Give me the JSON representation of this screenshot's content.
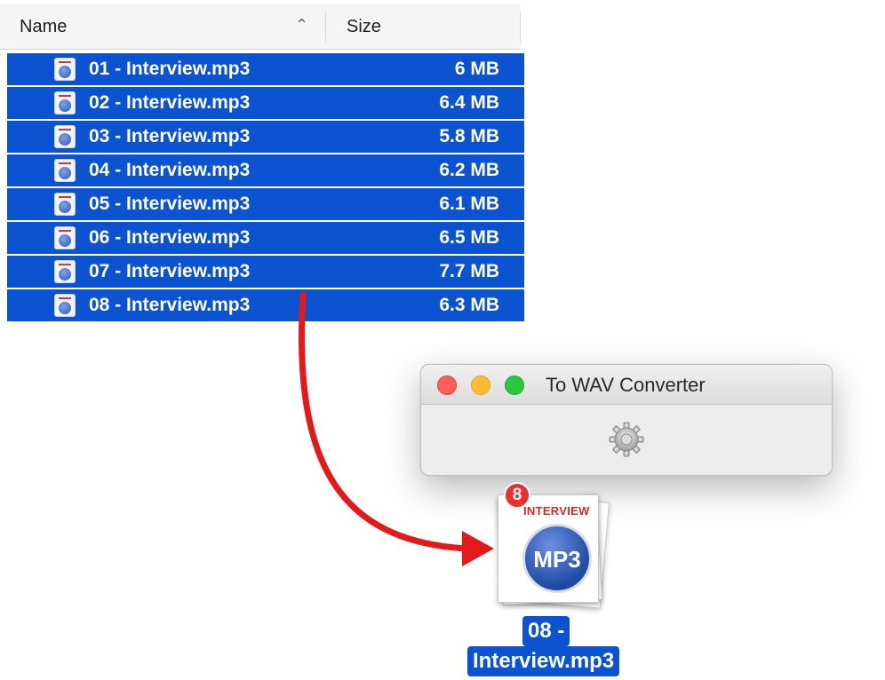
{
  "finder": {
    "columns": {
      "name": "Name",
      "size": "Size"
    },
    "rows": [
      {
        "name": "01 - Interview.mp3",
        "size": "6 MB"
      },
      {
        "name": "02 - Interview.mp3",
        "size": "6.4 MB"
      },
      {
        "name": "03 - Interview.mp3",
        "size": "5.8 MB"
      },
      {
        "name": "04 - Interview.mp3",
        "size": "6.2 MB"
      },
      {
        "name": "05 - Interview.mp3",
        "size": "6.1 MB"
      },
      {
        "name": "06 - Interview.mp3",
        "size": "6.5 MB"
      },
      {
        "name": "07 - Interview.mp3",
        "size": "7.7 MB"
      },
      {
        "name": "08 - Interview.mp3",
        "size": "6.3 MB"
      }
    ],
    "sort_icon": "chevron-up-icon",
    "selection_color": "#0b53d0"
  },
  "app_window": {
    "title": "To WAV Converter",
    "icon": "gear-icon"
  },
  "drag_preview": {
    "count_badge": "8",
    "doc_label": "INTERVIEW",
    "doc_badge_text": "MP3",
    "label_line1": "08 -",
    "label_line2": "Interview.mp3"
  },
  "colors": {
    "arrow": "#e3191a",
    "badge": "#e8322f"
  }
}
